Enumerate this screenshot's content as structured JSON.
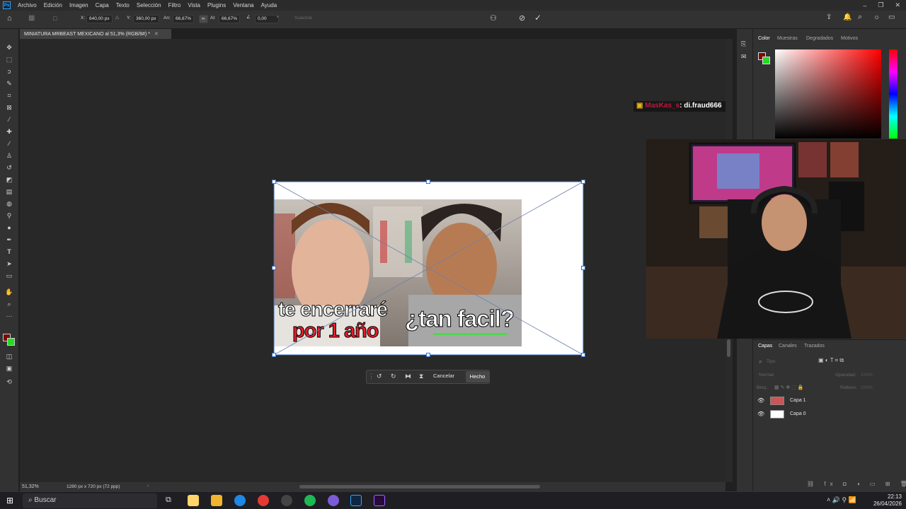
{
  "app": {
    "logo_text": "Ps"
  },
  "menu": [
    "Archivo",
    "Edición",
    "Imagen",
    "Capa",
    "Texto",
    "Selección",
    "Filtro",
    "Vista",
    "Plugins",
    "Ventana",
    "Ayuda"
  ],
  "options_bar": {
    "x_label": "X:",
    "x_value": "640,00 px",
    "y_label": "Y:",
    "y_value": "360,00 px",
    "w_label": "An:",
    "w_value": "66,67%",
    "h_label": "Al:",
    "h_value": "66,67%",
    "angle_value": "0,00",
    "degree": "°",
    "smooth_label": "Suavizar"
  },
  "document": {
    "tab_title": "MINIATURA MRBEAST MEXICANO al 51,3% (RGB/8#) *",
    "thumbnail_text_1": "te encerraré",
    "thumbnail_text_2": "por 1 año",
    "thumbnail_text_3": "¿tan facil?"
  },
  "transform_bar": {
    "cancel_label": "Cancelar",
    "done_label": "Hecho"
  },
  "status": {
    "zoom": "51,32%",
    "doc_info": "1280 px x 720 px (72 ppp)"
  },
  "color_panel": {
    "tabs": [
      "Color",
      "Muestras",
      "Degradados",
      "Motivos"
    ],
    "foreground_color": "#7a0b0b",
    "background_color": "#22dd22"
  },
  "layers_panel": {
    "tabs": [
      "Capas",
      "Canales",
      "Trazados"
    ],
    "search_placeholder": "Tipo",
    "blend_mode": "Normal",
    "opacity_label": "Opacidad:",
    "opacity_value": "100%",
    "lock_label": "Bloq.:",
    "fill_label": "Relleno:",
    "fill_value": "100%",
    "layers": [
      {
        "name": "Capa 1"
      },
      {
        "name": "Capa 0"
      }
    ]
  },
  "stream": {
    "chat_user": "MasKas_s",
    "chat_separator": ": ",
    "chat_message": "di.fraud666"
  },
  "taskbar": {
    "search_label": "Buscar",
    "time": "22:13",
    "date": "26/04/2026"
  },
  "accent_color": "#31a8ff"
}
